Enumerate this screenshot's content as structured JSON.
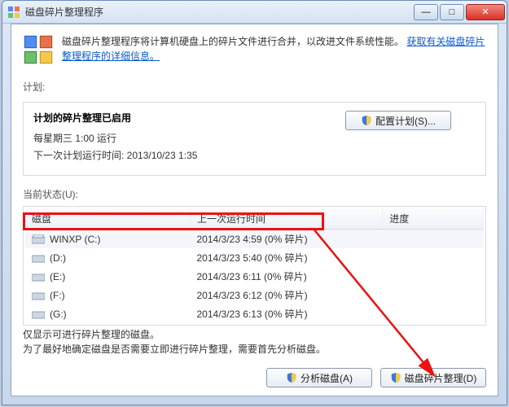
{
  "window": {
    "title": "磁盘碎片整理程序"
  },
  "intro": {
    "text": "磁盘碎片整理程序将计算机硬盘上的碎片文件进行合并，以改进文件系统性能。",
    "link": "获取有关磁盘碎片整理程序的详细信息。"
  },
  "labels": {
    "plan": "计划:",
    "status": "当前状态(U):"
  },
  "schedule": {
    "enabled_title": "计划的碎片整理已启用",
    "freq_line": "每星期三   1:00 运行",
    "next_line": "下一次计划运行时间: 2013/10/23 1:35",
    "configure_btn": "配置计划(S)..."
  },
  "table": {
    "headers": {
      "disk": "磁盘",
      "last": "上一次运行时间",
      "prog": "进度"
    },
    "rows": [
      {
        "name": "WINXP (C:)",
        "last": "2014/3/23 4:59 (0% 碎片)",
        "prog": ""
      },
      {
        "name": "(D:)",
        "last": "2014/3/23 5:40 (0% 碎片)",
        "prog": ""
      },
      {
        "name": "(E:)",
        "last": "2014/3/23 6:11 (0% 碎片)",
        "prog": ""
      },
      {
        "name": "(F:)",
        "last": "2014/3/23 6:12 (0% 碎片)",
        "prog": ""
      },
      {
        "name": "(G:)",
        "last": "2014/3/23 6:13 (0% 碎片)",
        "prog": ""
      }
    ]
  },
  "footnote": {
    "line1": "仅显示可进行碎片整理的磁盘。",
    "line2": "为了最好地确定磁盘是否需要立即进行碎片整理，需要首先分析磁盘。"
  },
  "buttons": {
    "analyze": "分析磁盘(A)",
    "defrag": "磁盘碎片整理(D)"
  }
}
